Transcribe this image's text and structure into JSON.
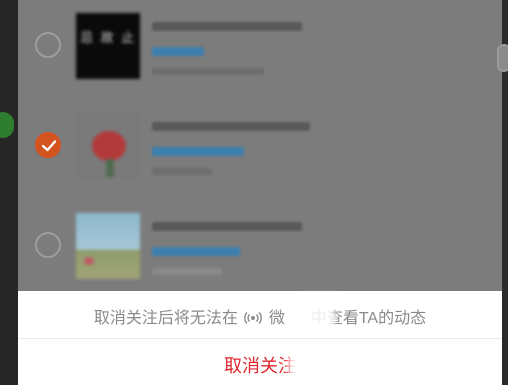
{
  "follow_list": {
    "items": [
      {
        "selected": false,
        "thumb_text": "忌 故 止",
        "thumbnail": "black-text-image"
      },
      {
        "selected": true,
        "thumbnail": "red-flower-image"
      },
      {
        "selected": false,
        "thumbnail": "meadow-sky-image"
      }
    ]
  },
  "sheet": {
    "message_before": "取消关注后将无法在",
    "broadcast_icon": "broadcast-icon",
    "message_app": "微",
    "message_after": "中查看TA的动态",
    "unfollow_label": "取消关注"
  },
  "colors": {
    "accent_check": "#d3541f",
    "danger_text": "#e0262d",
    "overlay": "#7c7c7c",
    "tag_blue": "#3c80ad"
  }
}
